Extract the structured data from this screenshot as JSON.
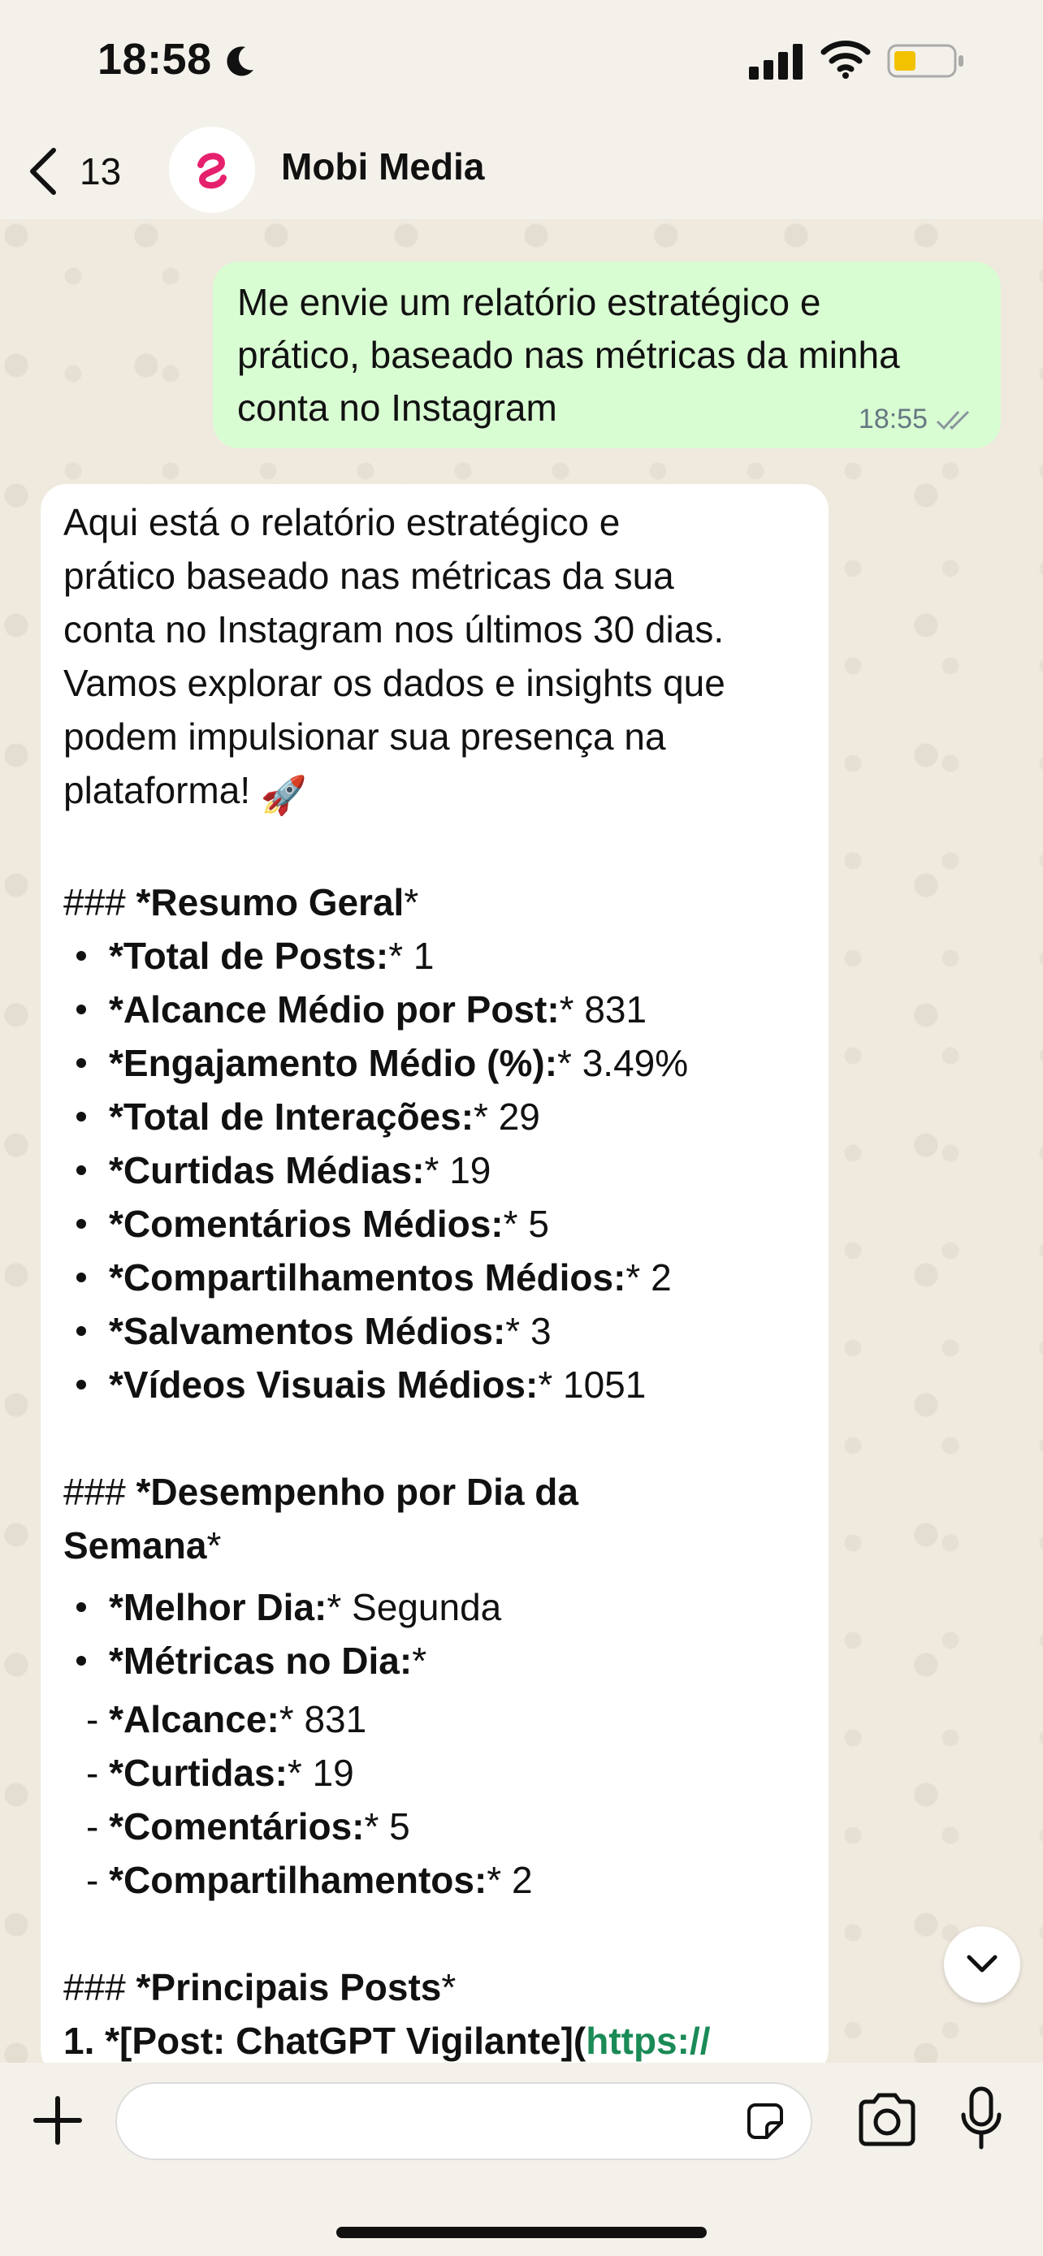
{
  "status": {
    "time": "18:58"
  },
  "header": {
    "back_count": "13",
    "contact_name": "Mobi Media"
  },
  "outgoing": {
    "lines": [
      "Me envie um relatório estratégico e",
      "prático, baseado nas métricas da minha",
      "conta no Instagram"
    ],
    "time": "18:55"
  },
  "incoming": {
    "intro": [
      "Aqui está o relatório estratégico e",
      "prático baseado nas métricas da sua",
      "conta no Instagram nos últimos 30 dias.",
      "Vamos explorar os dados e insights que",
      "podem impulsionar sua presença na",
      "plataforma!"
    ],
    "rocket": "🚀",
    "resumo_title_prefix": "### ",
    "resumo_title": "*Resumo Geral",
    "resumo_title_suffix": "*",
    "resumo": [
      {
        "label": "*Total de Posts:",
        "value": "* 1"
      },
      {
        "label": "*Alcance Médio por Post:",
        "value": "* 831"
      },
      {
        "label": "*Engajamento Médio (%):",
        "value": "* 3.49%"
      },
      {
        "label": "*Total de Interações:",
        "value": "* 29"
      },
      {
        "label": "*Curtidas Médias:",
        "value": "* 19"
      },
      {
        "label": "*Comentários Médios:",
        "value": "* 5"
      },
      {
        "label": "*Compartilhamentos Médios:",
        "value": "* 2"
      },
      {
        "label": "*Salvamentos Médios:",
        "value": "* 3"
      },
      {
        "label": "*Vídeos Visuais Médios:",
        "value": "* 1051"
      }
    ],
    "desempenho_title_line1": "*Desempenho por Dia da",
    "desempenho_title_line2": "Semana",
    "desempenho_title_suffix": "*",
    "desempenho": [
      {
        "label": "*Melhor Dia:",
        "value": "* Segunda"
      },
      {
        "label": "*Métricas no Dia:",
        "value": "*"
      }
    ],
    "metricas": [
      {
        "label": "*Alcance:",
        "value": "* 831"
      },
      {
        "label": "*Curtidas:",
        "value": "* 19"
      },
      {
        "label": "*Comentários:",
        "value": "* 5"
      },
      {
        "label": "*Compartilhamentos:",
        "value": "* 2"
      }
    ],
    "posts_title": "*Principais Posts",
    "posts_title_suffix": "*",
    "cut_line": "1. *[Post: ChatGPT Vigilante](",
    "cut_link": "https://"
  },
  "input": {
    "placeholder": ""
  }
}
